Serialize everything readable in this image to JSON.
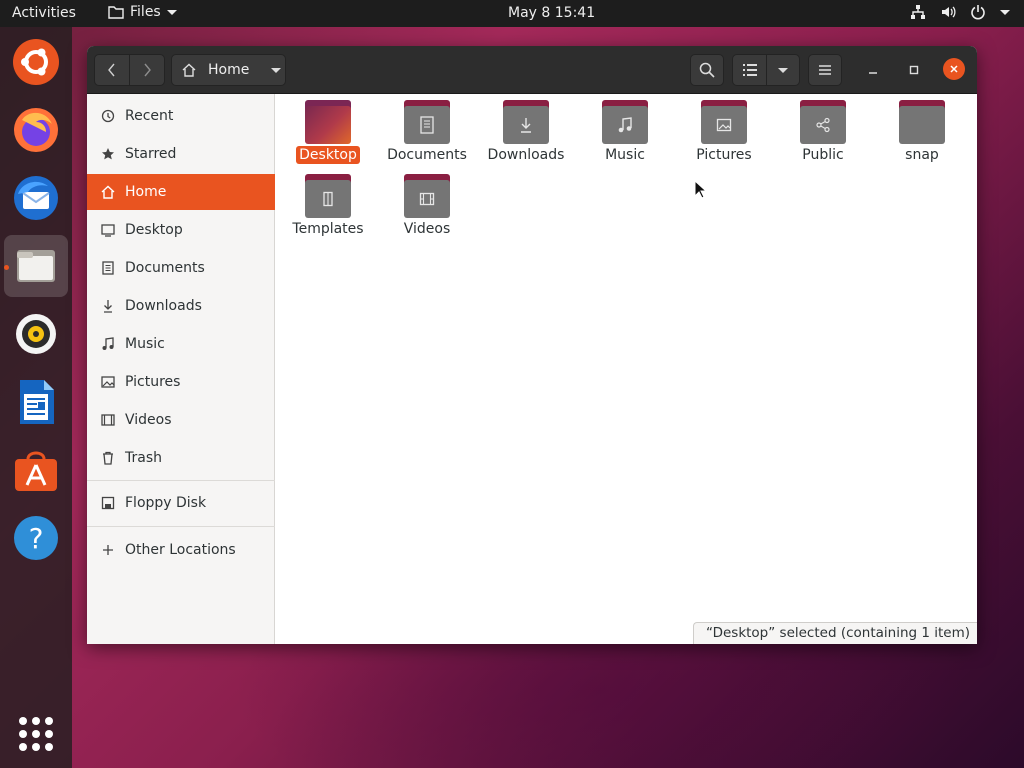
{
  "topbar": {
    "activities": "Activities",
    "app_menu": "Files",
    "clock": "May 8  15:41"
  },
  "dock": {
    "items": [
      "ubuntu-icon",
      "firefox-icon",
      "thunderbird-icon",
      "files-icon",
      "rhythmbox-icon",
      "libreoffice-writer-icon",
      "software-center-icon",
      "help-icon"
    ],
    "show_apps_icon": "apps-grid-icon"
  },
  "headerbar": {
    "path_label": "Home"
  },
  "sidebar": {
    "items": [
      {
        "label": "Recent",
        "icon": "clock-icon"
      },
      {
        "label": "Starred",
        "icon": "star-icon"
      },
      {
        "label": "Home",
        "icon": "home-icon"
      },
      {
        "label": "Desktop",
        "icon": "desktop-icon"
      },
      {
        "label": "Documents",
        "icon": "document-icon"
      },
      {
        "label": "Downloads",
        "icon": "download-icon"
      },
      {
        "label": "Music",
        "icon": "music-icon"
      },
      {
        "label": "Pictures",
        "icon": "picture-icon"
      },
      {
        "label": "Videos",
        "icon": "video-icon"
      },
      {
        "label": "Trash",
        "icon": "trash-icon"
      }
    ],
    "devices": [
      {
        "label": "Floppy Disk",
        "icon": "floppy-icon"
      }
    ],
    "other": [
      {
        "label": "Other Locations",
        "icon": "plus-icon"
      }
    ],
    "selected": "Home"
  },
  "files": [
    {
      "label": "Desktop",
      "emblem": "none"
    },
    {
      "label": "Documents",
      "emblem": "document-emblem"
    },
    {
      "label": "Downloads",
      "emblem": "download-emblem"
    },
    {
      "label": "Music",
      "emblem": "music-emblem"
    },
    {
      "label": "Pictures",
      "emblem": "picture-emblem"
    },
    {
      "label": "Public",
      "emblem": "share-emblem"
    },
    {
      "label": "snap",
      "emblem": "none"
    },
    {
      "label": "Templates",
      "emblem": "template-emblem"
    },
    {
      "label": "Videos",
      "emblem": "video-emblem"
    }
  ],
  "selected_file": "Desktop",
  "status": "“Desktop” selected  (containing 1 item)",
  "colors": {
    "accent": "#e95420",
    "folder": "#757575",
    "folder_tab": "#8a1f42",
    "headerbar": "#2d2d2d",
    "topbar": "#1d1d1d"
  }
}
